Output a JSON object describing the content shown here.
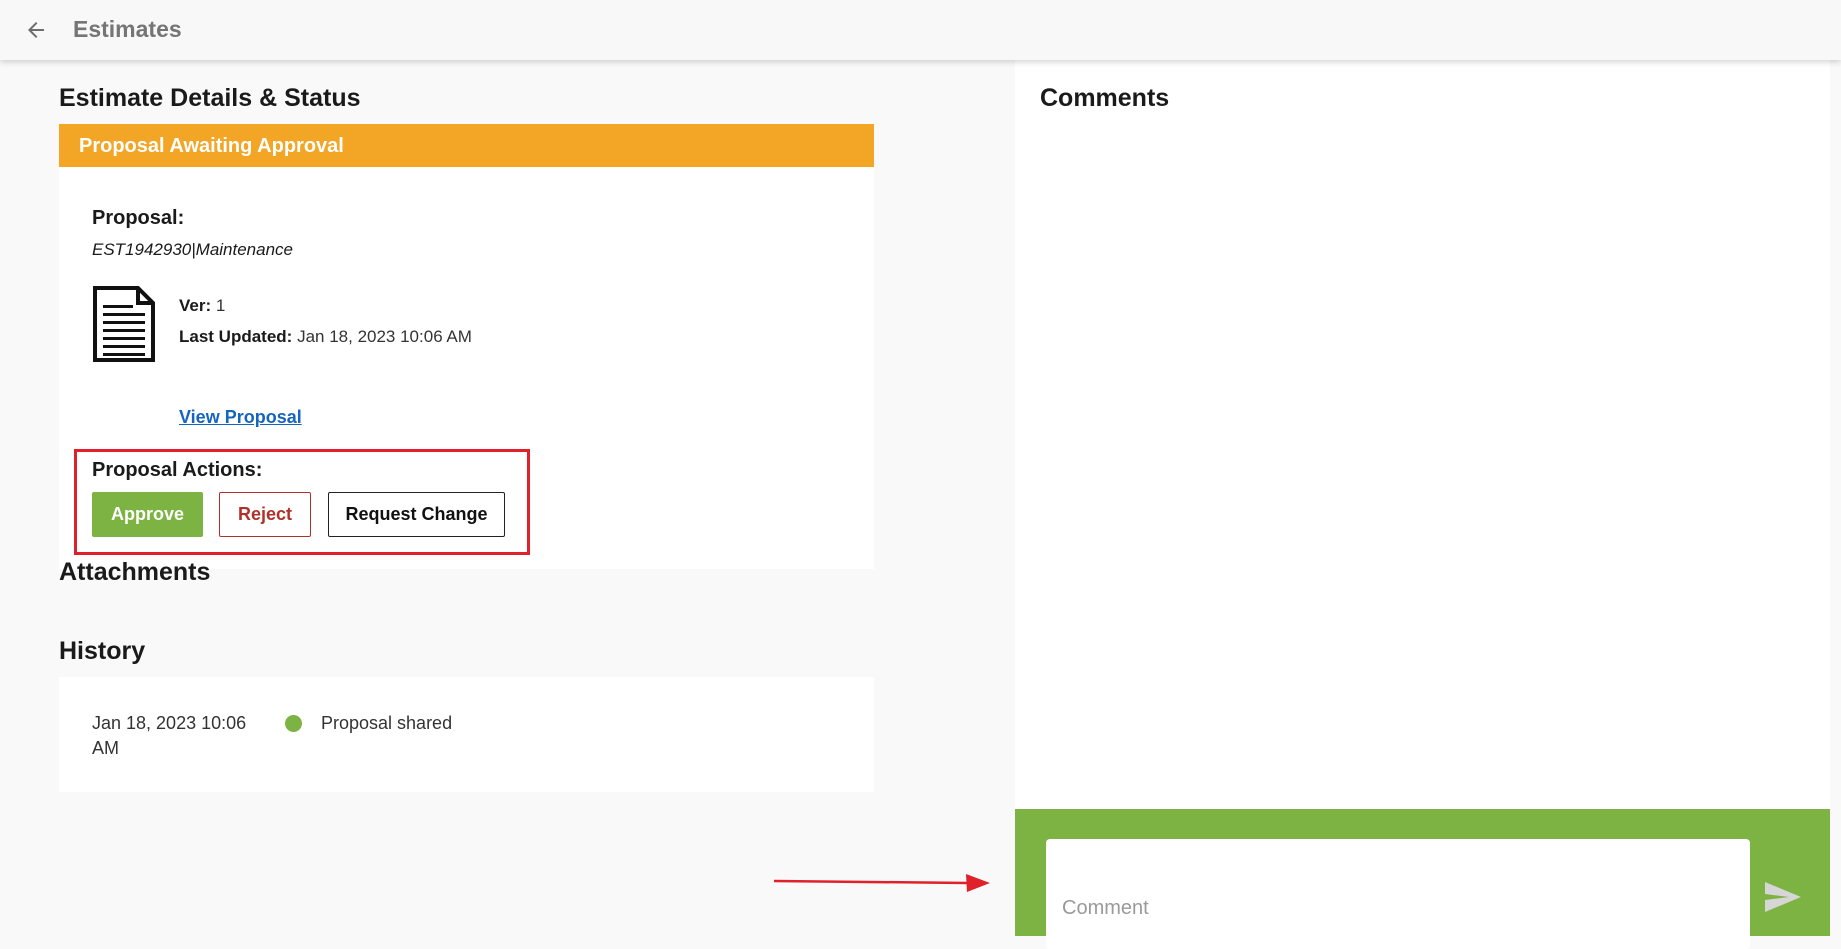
{
  "header": {
    "title": "Estimates",
    "back_icon": "arrow-left-icon"
  },
  "estimate_details": {
    "section_title": "Estimate Details & Status",
    "status_banner": "Proposal Awaiting Approval",
    "status_color": "#f3a525",
    "proposal_label": "Proposal:",
    "proposal_id": "EST1942930|Maintenance",
    "doc_icon": "document-icon",
    "version_label": "Ver:",
    "version_value": "1",
    "last_updated_label": "Last Updated:",
    "last_updated_value": "Jan 18, 2023 10:06 AM",
    "view_link": "View Proposal"
  },
  "proposal_actions": {
    "label": "Proposal Actions:",
    "approve": "Approve",
    "reject": "Reject",
    "request_change": "Request Change",
    "approve_color": "#7cb342",
    "reject_color": "#b0312a"
  },
  "attachments": {
    "title": "Attachments"
  },
  "history": {
    "title": "History",
    "entries": [
      {
        "date": "Jan 18, 2023 10:06 AM",
        "event": "Proposal shared",
        "dot_color": "#7cb342"
      }
    ]
  },
  "comments": {
    "title": "Comments",
    "placeholder": "Comment",
    "send_icon": "send-icon",
    "bar_color": "#7cb342"
  },
  "annotations": {
    "highlight_color": "#e0202a",
    "arrow_icon": "red-arrow-icon"
  }
}
